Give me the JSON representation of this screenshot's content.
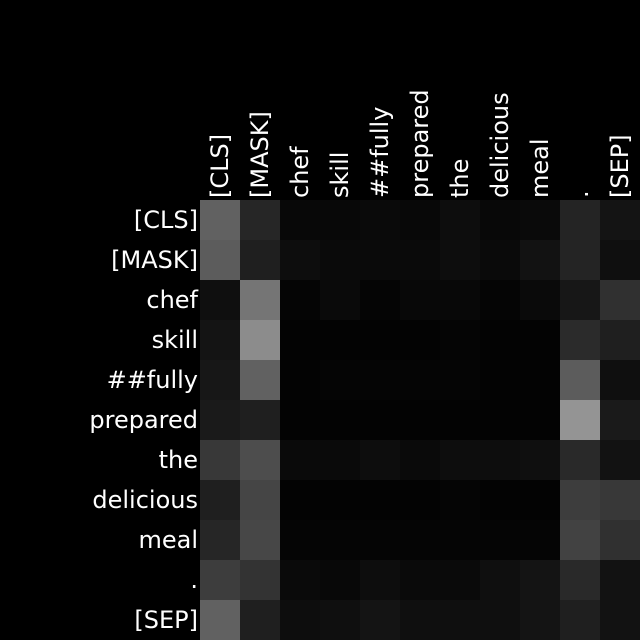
{
  "chart_data": {
    "type": "heatmap",
    "title": "",
    "xlabel": "",
    "ylabel": "",
    "colormap": "grayscale",
    "colors": {
      "background": "#000000",
      "text": "#ffffff"
    },
    "x_tokens": [
      "[CLS]",
      "[MASK]",
      "chef",
      "skill",
      "##fully",
      "prepared",
      "the",
      "delicious",
      "meal",
      ".",
      "[SEP]"
    ],
    "y_tokens": [
      "[CLS]",
      "[MASK]",
      "chef",
      "skill",
      "##fully",
      "prepared",
      "the",
      "delicious",
      "meal",
      ".",
      "[SEP]"
    ],
    "value_range": [
      0,
      1
    ],
    "values": [
      [
        0.38,
        0.15,
        0.03,
        0.03,
        0.04,
        0.03,
        0.05,
        0.03,
        0.04,
        0.14,
        0.08
      ],
      [
        0.36,
        0.12,
        0.05,
        0.04,
        0.04,
        0.04,
        0.05,
        0.04,
        0.07,
        0.14,
        0.06
      ],
      [
        0.06,
        0.46,
        0.02,
        0.04,
        0.02,
        0.03,
        0.03,
        0.02,
        0.04,
        0.09,
        0.19
      ],
      [
        0.08,
        0.55,
        0.01,
        0.01,
        0.01,
        0.01,
        0.02,
        0.01,
        0.01,
        0.17,
        0.12
      ],
      [
        0.09,
        0.38,
        0.01,
        0.02,
        0.02,
        0.02,
        0.02,
        0.01,
        0.01,
        0.36,
        0.06
      ],
      [
        0.1,
        0.12,
        0.01,
        0.01,
        0.01,
        0.01,
        0.01,
        0.01,
        0.01,
        0.58,
        0.1
      ],
      [
        0.22,
        0.3,
        0.04,
        0.04,
        0.05,
        0.04,
        0.05,
        0.05,
        0.06,
        0.16,
        0.07
      ],
      [
        0.12,
        0.27,
        0.01,
        0.01,
        0.01,
        0.01,
        0.02,
        0.01,
        0.01,
        0.24,
        0.22
      ],
      [
        0.15,
        0.28,
        0.02,
        0.02,
        0.02,
        0.02,
        0.02,
        0.02,
        0.02,
        0.26,
        0.19
      ],
      [
        0.24,
        0.2,
        0.04,
        0.03,
        0.05,
        0.04,
        0.04,
        0.06,
        0.08,
        0.16,
        0.07
      ],
      [
        0.38,
        0.12,
        0.05,
        0.06,
        0.08,
        0.06,
        0.06,
        0.06,
        0.08,
        0.12,
        0.07
      ]
    ]
  }
}
